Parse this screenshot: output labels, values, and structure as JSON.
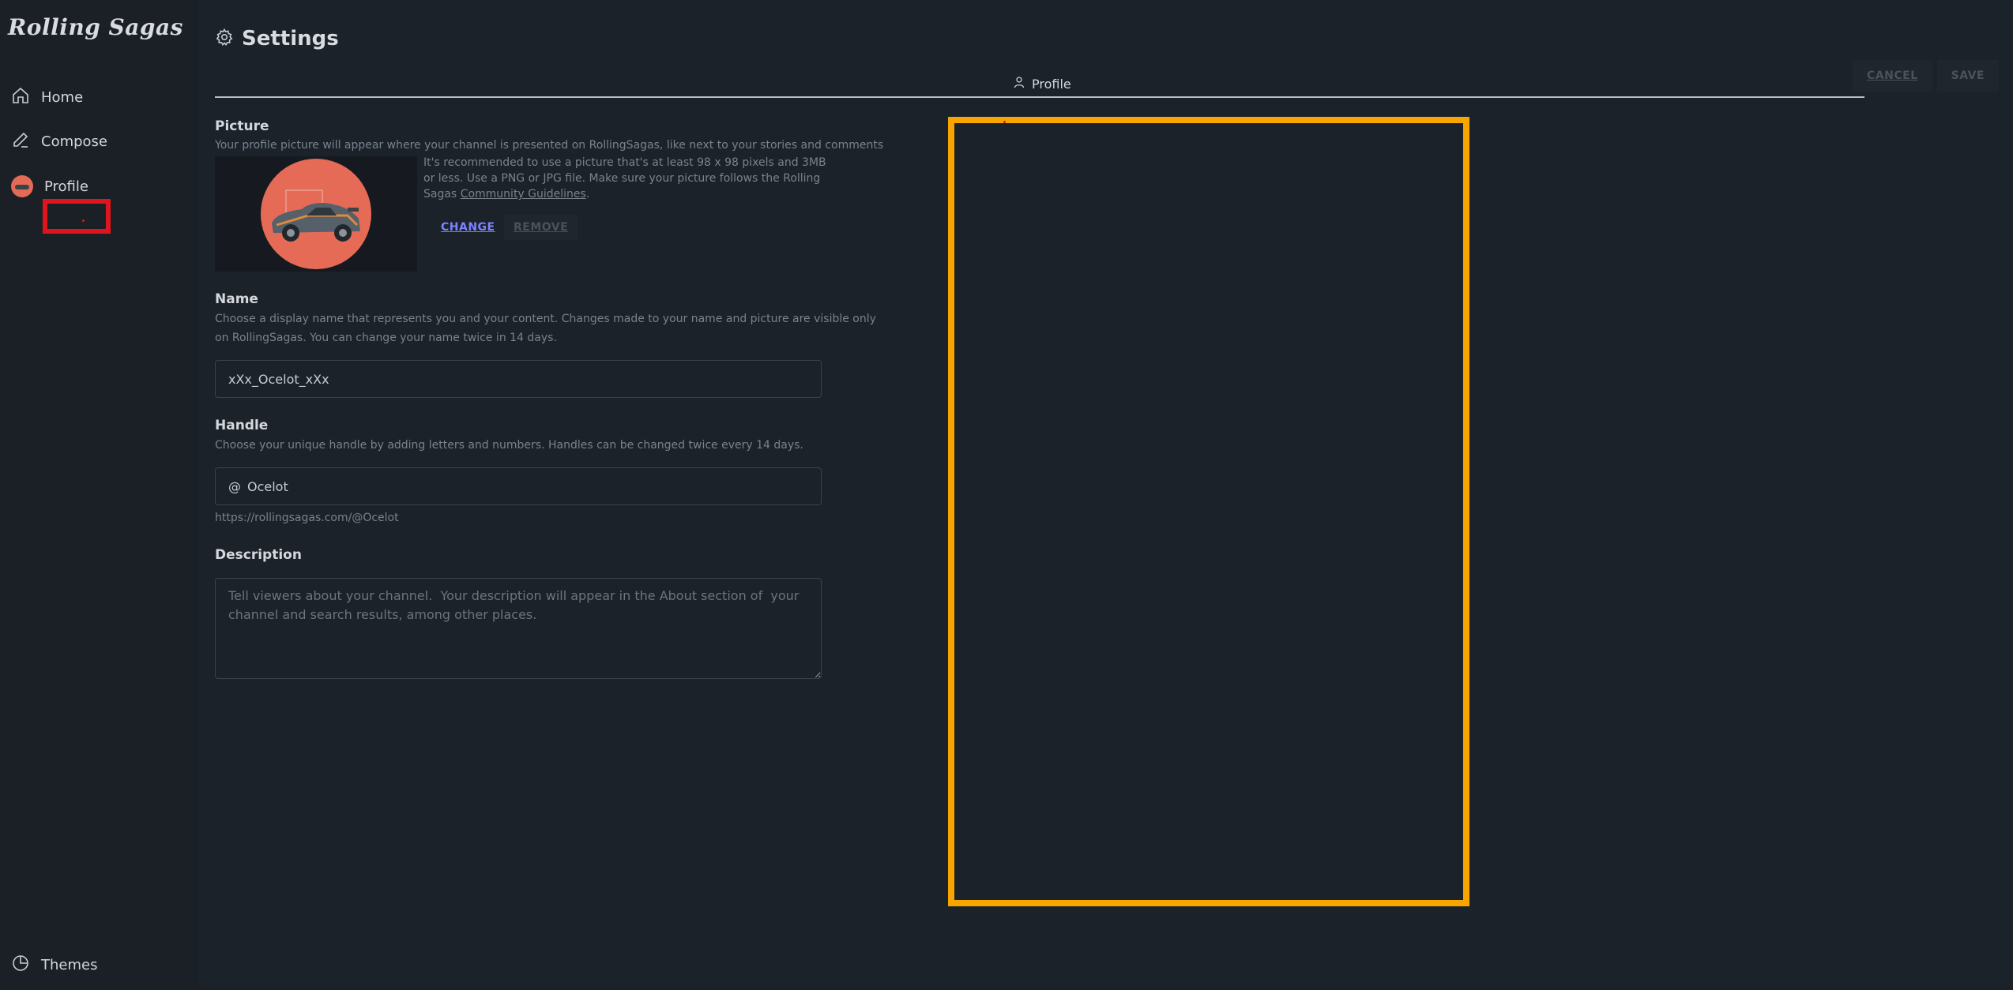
{
  "app": {
    "logo": "Rolling Sagas"
  },
  "sidebar": {
    "items": [
      {
        "label": "Home",
        "icon": "home-icon"
      },
      {
        "label": "Compose",
        "icon": "pencil-icon"
      },
      {
        "label": "Profile",
        "icon": "avatar"
      }
    ],
    "footer": {
      "label": "Themes",
      "icon": "palette-icon"
    }
  },
  "header": {
    "title": "Settings",
    "icon": "gear-icon"
  },
  "actions": {
    "cancel": "CANCEL",
    "save": "SAVE"
  },
  "tabs": [
    {
      "label": "Profile",
      "icon": "user-icon"
    }
  ],
  "picture": {
    "label": "Picture",
    "description": "Your profile picture will appear where your channel is presented on RollingSagas, like next to your stories and comments",
    "note": "It's recommended to use a picture that's at least 98 x 98 pixels and 3MB or less. Use a PNG or JPG file. Make sure your picture follows the Rolling Sagas",
    "note_link": "Community Guidelines",
    "note_end": ".",
    "change": "CHANGE",
    "remove": "REMOVE"
  },
  "name": {
    "label": "Name",
    "description_1": "Choose a display name that represents you and your content. Changes made to your name and picture are visible only",
    "description_2": "on RollingSagas. You can change your name twice in 14 days.",
    "value": "xXx_Ocelot_xXx"
  },
  "handle": {
    "label": "Handle",
    "description": "Choose your unique handle by adding letters and numbers. Handles can be changed twice every 14 days.",
    "prefix": "@",
    "value": "Ocelot",
    "url": "https://rollingsagas.com/@Ocelot"
  },
  "description": {
    "label": "Description",
    "placeholder": "Tell viewers about your channel.  Your description will appear in the About section of  your channel and search results, among other places."
  },
  "colors": {
    "background": "#1c222a",
    "sidebar": "#1b2026",
    "highlight_orange": "#f8a500",
    "highlight_red": "#e0141c",
    "accent_link": "#7c82ff",
    "avatar": "#e56b57"
  }
}
